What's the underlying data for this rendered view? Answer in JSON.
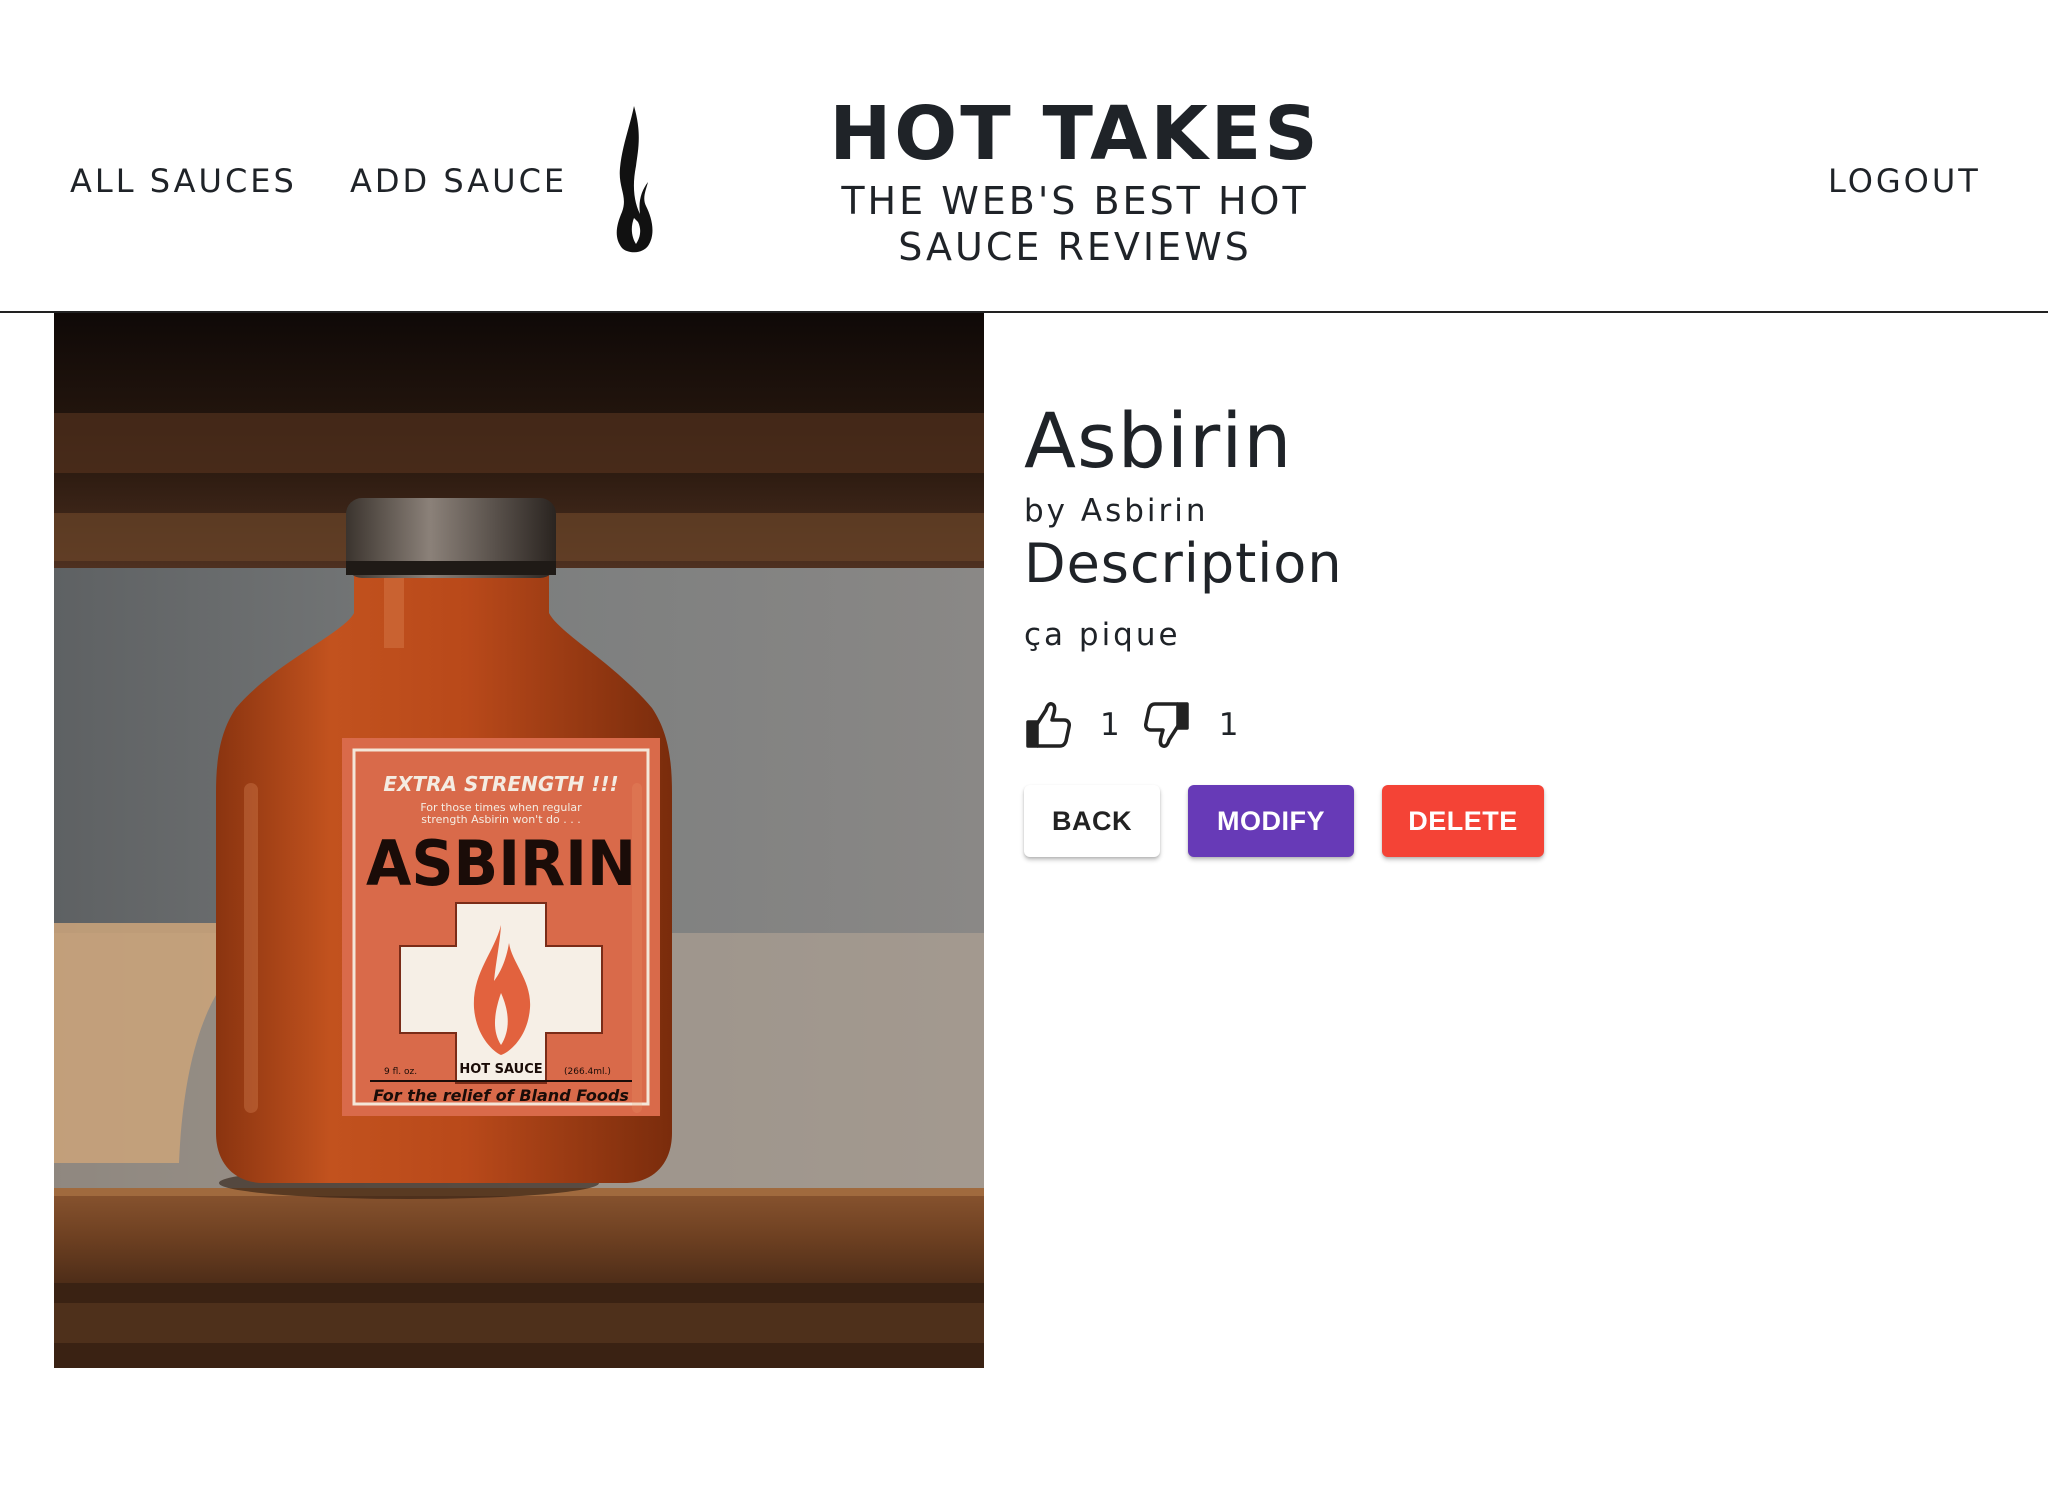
{
  "header": {
    "nav_all_sauces": "ALL SAUCES",
    "nav_add_sauce": "ADD SAUCE",
    "brand_title": "HOT TAKES",
    "brand_subtitle": "THE WEB'S BEST HOT SAUCE REVIEWS",
    "nav_logout": "LOGOUT",
    "logo_icon": "flame-icon"
  },
  "sauce": {
    "image": {
      "label_tagline": "EXTRA STRENGTH !!!",
      "label_subline_1": "For those times when regular",
      "label_subline_2": "strength Asbirin won't do . . .",
      "label_brand": "ASBIRIN",
      "label_hot_sauce": "HOT SAUCE",
      "label_volume_oz": "9 fl. oz.",
      "label_volume_ml": "(266.4ml.)",
      "label_footer": "For the relief of Bland Foods"
    },
    "name": "Asbirin",
    "manufacturer": "by Asbirin",
    "description_heading": "Description",
    "description": "ça pique",
    "likes": "1",
    "dislikes": "1",
    "like_icon": "thumbs-up-icon",
    "dislike_icon": "thumbs-down-icon"
  },
  "actions": {
    "back_label": "BACK",
    "modify_label": "MODIFY",
    "delete_label": "DELETE"
  },
  "colors": {
    "modify": "#673ab7",
    "delete": "#f44336"
  }
}
